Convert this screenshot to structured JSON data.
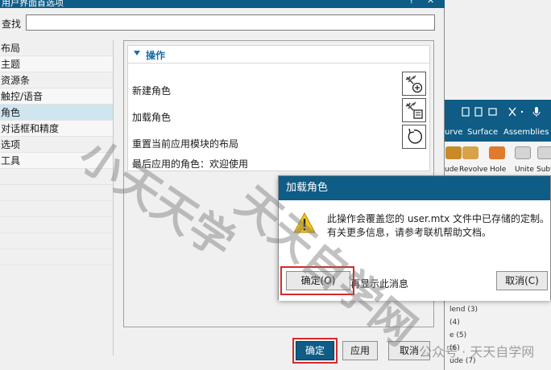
{
  "window": {
    "title": "用户界面首选项",
    "help_glyph": "?",
    "close_glyph": "✕"
  },
  "search": {
    "label": "查找",
    "value": ""
  },
  "categories": [
    "布局",
    "主题",
    "资源条",
    "触控/语音",
    "角色",
    "对话框和精度",
    "选项",
    "工具"
  ],
  "selected_category": "角色",
  "panel": {
    "section_title": "操作",
    "rows": [
      {
        "label": "新建角色",
        "icon": "new-role-icon"
      },
      {
        "label": "加载角色",
        "icon": "load-role-icon"
      },
      {
        "label": "重置当前应用模块的布局",
        "icon": "reset-layout-icon"
      }
    ],
    "last_role": "最后应用的角色：欢迎使用"
  },
  "buttons": {
    "ok": "确定",
    "apply": "应用",
    "cancel": "取消"
  },
  "background_app": {
    "tabs": [
      "urve",
      "Surface",
      "Assemblies"
    ],
    "ribbon": [
      "ude",
      "Revolve",
      "Hole",
      "Unite",
      "Subt"
    ],
    "tree": [
      "lend (3)",
      "(4)",
      "e (5)",
      "(6)",
      "ude (7)"
    ]
  },
  "alert": {
    "title": "加载角色",
    "line1": "此操作会覆盖您的 user.mtx 文件中已存储的定制。",
    "line2": "有关更多信息，请参考联机帮助文档。",
    "checkbox_label": "不再显示此消息",
    "ok": "确定(O)",
    "cancel": "取消(C)"
  },
  "watermark": {
    "text": "小天天学",
    "text2": "天天自学网",
    "corner": "公众号 · 天天自学网"
  },
  "colors": {
    "title_blue": "#0f5c86",
    "highlight_red": "#d62a2a",
    "selection": "#cfe6f1"
  }
}
